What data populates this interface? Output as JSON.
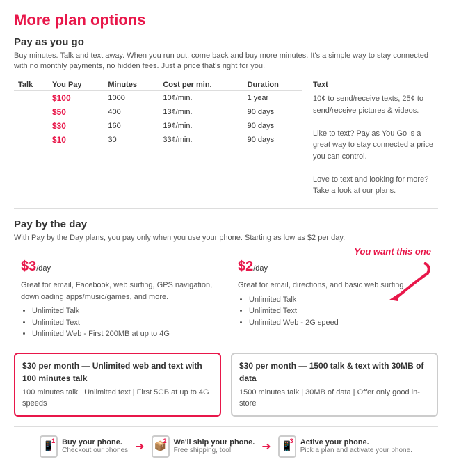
{
  "page": {
    "title": "More plan options"
  },
  "payasyougo": {
    "section_title": "Pay as you go",
    "section_desc": "Buy minutes. Talk and text away. When you run out, come back and buy more minutes. It's a simple way to stay connected with no monthly payments, no hidden fees. Just a price that's right for you.",
    "table": {
      "headers": [
        "Talk",
        "You Pay",
        "Minutes",
        "Cost per min.",
        "Duration"
      ],
      "rows": [
        {
          "you_pay": "$100",
          "minutes": "1000",
          "cost": "10¢/min.",
          "duration": "1 year"
        },
        {
          "you_pay": "$50",
          "minutes": "400",
          "cost": "13¢/min.",
          "duration": "90 days"
        },
        {
          "you_pay": "$30",
          "minutes": "160",
          "cost": "19¢/min.",
          "duration": "90 days"
        },
        {
          "you_pay": "$10",
          "minutes": "30",
          "cost": "33¢/min.",
          "duration": "90 days"
        }
      ]
    },
    "text_section": {
      "header": "Text",
      "line1": "10¢ to send/receive texts, 25¢ to send/receive pictures & videos.",
      "line2": "Like to text? Pay as You Go is a great way to stay connected a price you can control.",
      "line3": "Love to text and looking for more? Take a look at our plans."
    }
  },
  "paybyday": {
    "section_title": "Pay by the day",
    "section_desc": "With Pay by the Day plans, you pay only when you use your phone. Starting as low as $2 per day.",
    "annotation": "You want this one",
    "plans": [
      {
        "price": "$3",
        "price_unit": "/day",
        "desc": "Great for email, Facebook, web surfing, GPS navigation, downloading apps/music/games, and more.",
        "bullets": [
          "Unlimited Talk",
          "Unlimited Text",
          "Unlimited Web - First 200MB at up to 4G"
        ]
      },
      {
        "price": "$2",
        "price_unit": "/day",
        "desc": "Great for email, directions, and basic web surfing",
        "bullets": [
          "Unlimited Talk",
          "Unlimited Text",
          "Unlimited Web - 2G speed"
        ]
      }
    ]
  },
  "bottom_plans": [
    {
      "title": "$30 per month — Unlimited web and text with 100 minutes talk",
      "desc": "100 minutes talk | Unlimited text | First 5GB at up to 4G speeds",
      "highlight": true
    },
    {
      "title": "$30 per month — 1500 talk & text with 30MB of data",
      "desc": "1500 minutes talk | 30MB of data | Offer only good in-store",
      "highlight": false
    }
  ],
  "footer_steps": [
    {
      "number": "1",
      "label": "Buy your phone.",
      "sublabel": "Checkout our phones"
    },
    {
      "number": "2",
      "label": "We'll ship your phone.",
      "sublabel": "Free shipping, too!"
    },
    {
      "number": "3",
      "label": "Active your phone.",
      "sublabel": "Pick a plan and activate your phone."
    }
  ]
}
